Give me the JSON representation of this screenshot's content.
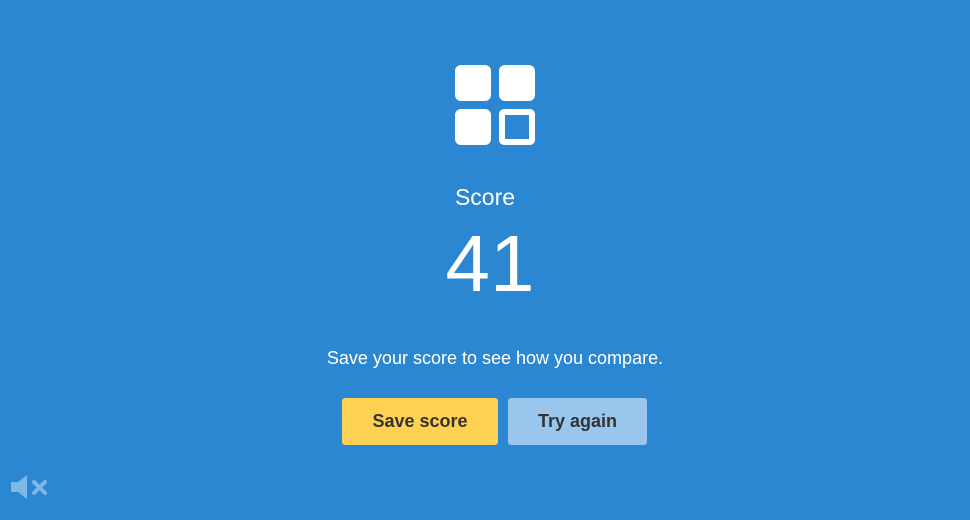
{
  "score_label": "Score",
  "score_value": "41",
  "prompt": "Save your score to see how you compare.",
  "buttons": {
    "save": "Save score",
    "try_again": "Try again"
  },
  "icons": {
    "logo": "grid-squares-icon",
    "mute": "speaker-muted-icon"
  },
  "colors": {
    "background": "#2b87d1",
    "save_button": "#ffd152",
    "try_button": "#99c6ed",
    "button_text": "#333333",
    "mute_icon": "#7db8e6"
  }
}
